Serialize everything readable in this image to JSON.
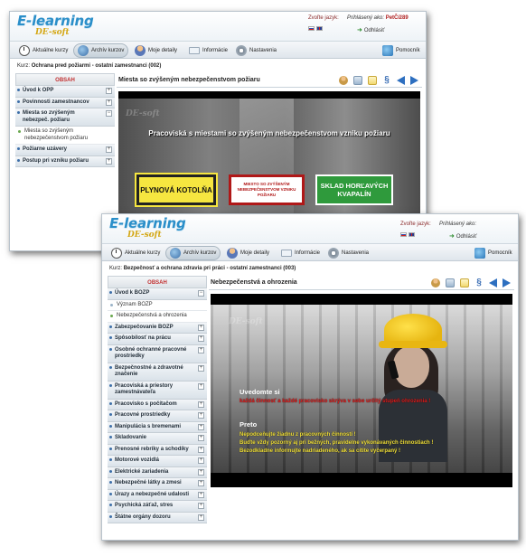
{
  "common": {
    "logo": "E-learning",
    "logo_sub": "DE-soft",
    "lang_label": "Zvoľte jazyk:",
    "logged_label": "Prihlásený ako:",
    "logout": "Odhlásiť",
    "nav": {
      "current": "Aktuálne kurzy",
      "archive": "Archív kurzov",
      "details": "Moje detaily",
      "info": "Informácie",
      "settings": "Nastavenia",
      "help": "Pomocník"
    },
    "course_prefix": "Kurz:",
    "obsah": "OBSAH",
    "watermark": "DE-soft"
  },
  "win1": {
    "user": "PetČíž89",
    "course_name": "Ochrana pred požiarmi - ostatní zamestnanci (002)",
    "content_title": "Miesta so zvýšeným nebezpečenstvom požiaru",
    "sidebar": [
      {
        "label": "Úvod k OPP"
      },
      {
        "label": "Povinnosti zamestnancov"
      },
      {
        "label": "Miesta so zvýšeným nebezpeč. požiaru"
      }
    ],
    "sub": [
      "Miesta so zvýšeným nebezpečenstvom požiaru"
    ],
    "sidebar2": [
      {
        "label": "Požiarne uzávery"
      },
      {
        "label": "Postup pri vzniku požiaru"
      }
    ],
    "video_heading": "Pracoviská s miestami so zvýšeným nebezpečenstvom vzniku požiaru",
    "sign_yellow": "PLYNOVÁ KOTOLŇA",
    "sign_white": "MIESTO SO ZVÝŠENÝM NEBEZPEČENSTVOM VZNIKU POŽIARU",
    "sign_green": "SKLAD HORĽAVÝCH KVAPALÍN"
  },
  "win2": {
    "user": "",
    "course_name": "Bezpečnosť a ochrana zdravia pri práci - ostatní zamestnanci (003)",
    "content_title": "Nebezpečenstvá a ohrozenia",
    "sidebar_top": {
      "label": "Úvod k BOZP"
    },
    "sub": [
      "Význam BOZP",
      "Nebezpečenstvá a ohrozenia"
    ],
    "sidebar": [
      {
        "label": "Zabezpečovanie BOZP"
      },
      {
        "label": "Spôsobilosť na prácu"
      },
      {
        "label": "Osobné ochranné pracovné prostriedky"
      },
      {
        "label": "Bezpečnostné a zdravotné značenie"
      },
      {
        "label": "Pracoviská a priestory zamestnávateľa"
      },
      {
        "label": "Pracovisko s počítačom"
      },
      {
        "label": "Pracovné prostriedky"
      },
      {
        "label": "Manipulácia s bremenami"
      },
      {
        "label": "Skladovanie"
      },
      {
        "label": "Prenosné rebríky a schodíky"
      },
      {
        "label": "Motorové vozidlá"
      },
      {
        "label": "Elektrické zariadenia"
      },
      {
        "label": "Nebezpečné látky a zmesi"
      },
      {
        "label": "Úrazy a nebezpečné udalosti"
      },
      {
        "label": "Psychická záťaž, stres"
      },
      {
        "label": "Štátne orgány dozoru"
      }
    ],
    "video": {
      "h1": "Uvedomte si",
      "red": "každá činnosť a každé pracovisko skrýva v sebe určitý stupeň ohrozenia !",
      "h2": "Preto",
      "yellow": [
        "Nepodceňujte žiadnu z pracovných činností !",
        "Buďte vždy pozorný aj pri bežných, pravidelne vykonávaných činnostiach !",
        "Bezodkladne informujte nadriadeného, ak sa cítite vyčerpaný !"
      ]
    }
  },
  "colors": {
    "accent": "#2b8fc9",
    "obsah": "#c23030",
    "warning_red": "#e11d1d",
    "warning_yellow": "#f1e03a"
  }
}
